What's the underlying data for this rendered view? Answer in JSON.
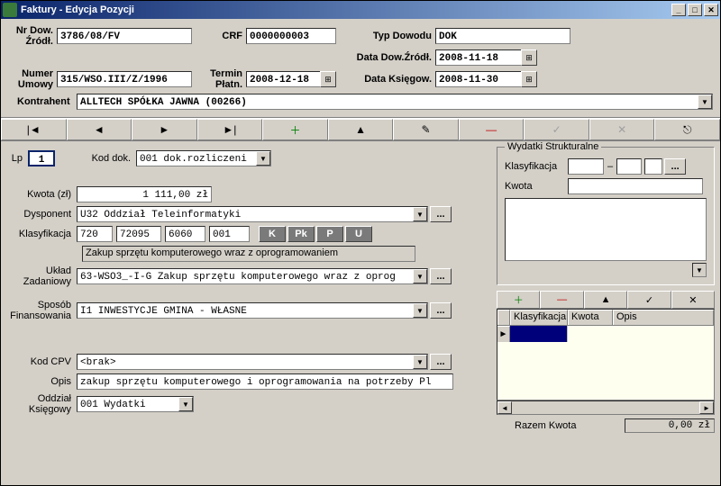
{
  "window": {
    "title": "Faktury - Edycja Pozycji"
  },
  "header": {
    "nr_dow_label": "Nr Dow. Źródł.",
    "nr_dow_value": "3786/08/FV",
    "crf_label": "CRF",
    "crf_value": "0000000003",
    "typ_dowodu_label": "Typ Dowodu",
    "typ_dowodu_value": "DOK",
    "numer_umowy_label": "Numer Umowy",
    "numer_umowy_value": "315/WSO.III/Z/1996",
    "termin_platn_label": "Termin Płatn.",
    "termin_platn_value": "2008-12-18",
    "data_dow_label": "Data Dow.Źródł.",
    "data_dow_value": "2008-11-18",
    "data_ksieg_label": "Data Księgow.",
    "data_ksieg_value": "2008-11-30",
    "kontrahent_label": "Kontrahent",
    "kontrahent_value": "ALLTECH  SPÓŁKA JAWNA (00266)"
  },
  "form": {
    "lp_label": "Lp",
    "lp_value": "1",
    "kod_dok_label": "Kod dok.",
    "kod_dok_value": "001 dok.rozliczeni",
    "kwota_label": "Kwota (zł)",
    "kwota_value": "1 111,00 zł",
    "dysponent_label": "Dysponent",
    "dysponent_value": "U32  Oddział Teleinformatyki",
    "klasyfikacja_label": "Klasyfikacja",
    "klas1": "720",
    "klas2": "72095",
    "klas3": "6060",
    "klas4": "001",
    "seg_k": "K",
    "seg_pk": "Pk",
    "seg_p": "P",
    "seg_u": "U",
    "klas_desc": "Zakup sprzętu komputerowego wraz z oprogramowaniem",
    "uklad_label": "Układ Zadaniowy",
    "uklad_value": "63-WSO3_-I-G  Zakup sprzętu komputerowego wraz z oprog",
    "sposob_label": "Sposób Finansowania",
    "sposob_value": "I1  INWESTYCJE GMINA - WŁASNE",
    "kod_cpv_label": "Kod CPV",
    "kod_cpv_value": "<brak>",
    "opis_label": "Opis",
    "opis_value": "zakup sprzętu komputerowego i oprogramowania na potrzeby Pl",
    "oddzial_label": "Oddział Księgowy",
    "oddzial_value": "001  Wydatki"
  },
  "ws": {
    "title": "Wydatki Strukturalne",
    "klas_label": "Klasyfikacja",
    "kwota_label": "Kwota",
    "dash": "–",
    "grid_h1": "Klasyfikacja",
    "grid_h2": "Kwota",
    "grid_h3": "Opis",
    "razem_label": "Razem Kwota",
    "razem_value": "0,00 zł"
  },
  "icons": {
    "first": "|◄",
    "prev": "◄",
    "next": "►",
    "last": "►|",
    "plus": "＋",
    "up": "▲",
    "edit": "✎",
    "minus": "—",
    "check": "✓",
    "x": "✕",
    "exit": "⎋",
    "dots": "...",
    "dd": "▼",
    "cal": "⊞",
    "ptr": "►",
    "scr_l": "◄",
    "scr_r": "►"
  }
}
